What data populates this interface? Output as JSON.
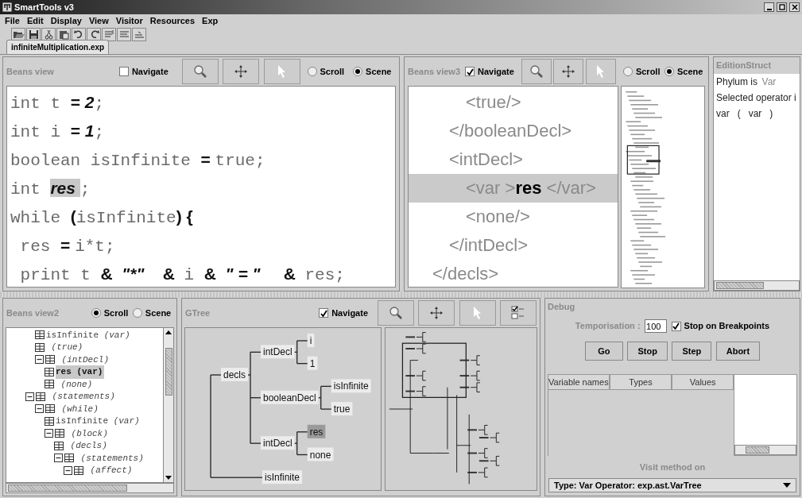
{
  "window": {
    "title": "SmartTools v3"
  },
  "menu": [
    "File",
    "Edit",
    "Display",
    "View",
    "Visitor",
    "Resources",
    "Exp"
  ],
  "document_tabs": [
    {
      "label": "infiniteMultiplication.exp",
      "selected": true
    }
  ],
  "beans_view": {
    "title": "Beans view",
    "navigate": {
      "label": "Navigate",
      "checked": false
    },
    "modes": [
      {
        "label": "Scroll",
        "selected": false
      },
      {
        "label": "Scene",
        "selected": true
      }
    ],
    "code_lines": [
      {
        "tokens": [
          {
            "text": "int t ",
            "kind": "code"
          },
          {
            "text": "= ",
            "kind": "operator"
          },
          {
            "text": "2",
            "kind": "literal"
          },
          {
            "text": ";",
            "kind": "code"
          }
        ]
      },
      {
        "tokens": [
          {
            "text": "int i ",
            "kind": "code"
          },
          {
            "text": "= ",
            "kind": "operator"
          },
          {
            "text": "1",
            "kind": "literal"
          },
          {
            "text": ";",
            "kind": "code"
          }
        ]
      },
      {
        "tokens": [
          {
            "text": "boolean isInfinite ",
            "kind": "code"
          },
          {
            "text": "= ",
            "kind": "operator"
          },
          {
            "text": "true;",
            "kind": "code"
          }
        ]
      },
      {
        "tokens": [
          {
            "text": "int ",
            "kind": "code"
          },
          {
            "text": "res ",
            "kind": "selection"
          },
          {
            "text": ";",
            "kind": "code"
          }
        ]
      },
      {
        "tokens": [
          {
            "text": "while ",
            "kind": "code"
          },
          {
            "text": "(",
            "kind": "operator"
          },
          {
            "text": "isInfinite",
            "kind": "code"
          },
          {
            "text": ") {",
            "kind": "operator"
          }
        ]
      },
      {
        "tokens": [
          {
            "text": " res ",
            "kind": "code"
          },
          {
            "text": "= ",
            "kind": "operator"
          },
          {
            "text": "i*t;",
            "kind": "code"
          }
        ]
      },
      {
        "tokens": [
          {
            "text": " print t ",
            "kind": "code"
          },
          {
            "text": "&  ",
            "kind": "operator"
          },
          {
            "text": "\"*\"",
            "kind": "literal"
          },
          {
            "text": "    &  ",
            "kind": "operator"
          },
          {
            "text": "i ",
            "kind": "code"
          },
          {
            "text": "&  ",
            "kind": "operator"
          },
          {
            "text": "\" = \"",
            "kind": "literal"
          },
          {
            "text": "     &  ",
            "kind": "operator"
          },
          {
            "text": "res;",
            "kind": "code"
          }
        ]
      }
    ]
  },
  "beans_view3": {
    "title": "Beans view3",
    "navigate": {
      "label": "Navigate",
      "checked": true
    },
    "modes": [
      {
        "label": "Scroll",
        "selected": false
      },
      {
        "label": "Scene",
        "selected": true
      }
    ],
    "xml_lines": [
      {
        "children": [
          {
            "children": [
              {
                "text": "<true/>",
                "selected": false
              }
            ]
          },
          {
            "text": "</booleanDecl>",
            "selected": false
          },
          {
            "text": "<intDecl>",
            "selected": false,
            "children": [
              {
                "text": "<var >**res** </var>",
                "selected": true
              },
              {
                "text": "<none/>",
                "selected": false
              }
            ]
          },
          {
            "text": "</intDecl>",
            "selected": false
          }
        ]
      },
      {
        "text": "</decls>",
        "selected": false
      }
    ]
  },
  "edition_struct": {
    "title": "EditionStruct",
    "lines": [
      {
        "label": "Phylum is",
        "value": "Var"
      },
      {
        "label": "Selected operator i"
      },
      {
        "label": "var   (   var   )"
      }
    ]
  },
  "beans_view2": {
    "title": "Beans view2",
    "modes": [
      {
        "label": "Scroll",
        "selected": true
      },
      {
        "label": "Scene",
        "selected": false
      }
    ],
    "tree": [
      {
        "children": [
          {
            "name": "isInfinite",
            "type": "(var)",
            "expanded": false,
            "selected": false
          },
          {
            "type": "(true)",
            "expanded": false,
            "selected": false
          },
          {
            "type": "(intDecl)",
            "expanded": true,
            "selected": false,
            "children": [
              {
                "name": "res",
                "type": "(var)",
                "expanded": false,
                "selected": true
              },
              {
                "type": "(none)",
                "expanded": false,
                "selected": false
              }
            ]
          }
        ]
      },
      {
        "type": "(statements)",
        "expanded": true,
        "selected": false,
        "children": [
          {
            "type": "(while)",
            "expanded": true,
            "selected": false,
            "children": [
              {
                "name": "isInfinite",
                "type": "(var)",
                "expanded": false,
                "selected": false
              },
              {
                "type": "(block)",
                "expanded": true,
                "selected": false,
                "children": [
                  {
                    "type": "(decls)",
                    "expanded": false,
                    "selected": false
                  },
                  {
                    "type": "(statements)",
                    "expanded": true,
                    "selected": false,
                    "children": [
                      {
                        "type": "(affect)",
                        "expanded": true,
                        "selected": false
                      }
                    ]
                  }
                ]
              }
            ]
          }
        ]
      }
    ]
  },
  "gtree": {
    "title": "GTree",
    "navigate": {
      "label": "Navigate",
      "checked": true
    },
    "tree": {
      "children": [
        {
          "label": "decls",
          "selected": false,
          "children": [
            {
              "label": "intDecl",
              "selected": false,
              "children": [
                {
                  "label": "i",
                  "selected": false
                },
                {
                  "label": "1",
                  "selected": false
                }
              ]
            },
            {
              "label": "booleanDecl",
              "selected": false,
              "children": [
                {
                  "label": "isInfinite",
                  "selected": false
                },
                {
                  "label": "true",
                  "selected": false
                }
              ]
            },
            {
              "label": "intDecl",
              "selected": false,
              "children": [
                {
                  "label": "res",
                  "selected": true
                },
                {
                  "label": "none",
                  "selected": false
                }
              ]
            }
          ]
        },
        {
          "children": [
            {
              "children": [
                {
                  "children": [
                    {
                      "children": [
                        {
                          "label": "isInfinite",
                          "selected": false
                        }
                      ]
                    }
                  ]
                }
              ]
            }
          ]
        }
      ]
    }
  },
  "debug": {
    "title": "Debug",
    "temporisation": {
      "label": "Temporisation :",
      "value": "100"
    },
    "stop_on_breakpoints": {
      "label": "Stop on Breakpoints",
      "checked": true
    },
    "buttons": [
      "Go",
      "Stop",
      "Step",
      "Abort"
    ],
    "table": {
      "columns": [
        "Variable names",
        "Types",
        "Values"
      ]
    },
    "visit_label": "Visit method on",
    "visit_select": {
      "value": "Type: Var Operator: exp.ast.VarTree"
    }
  }
}
